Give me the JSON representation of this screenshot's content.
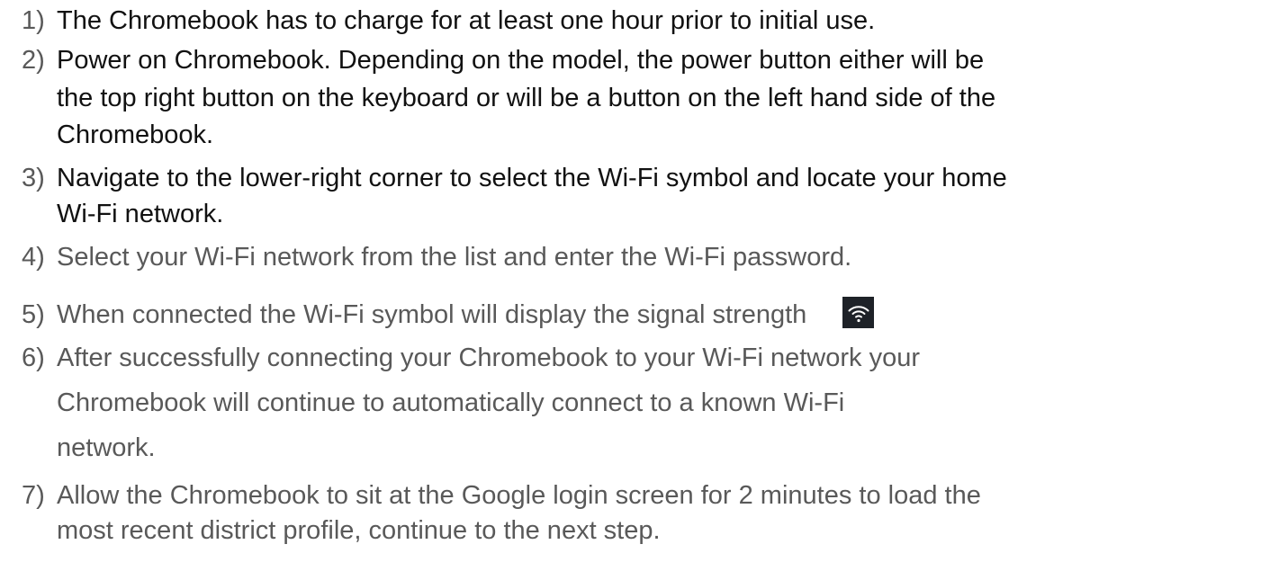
{
  "steps": [
    {
      "number": "1)",
      "lines": [
        "The Chromebook has to charge for at least one hour prior to initial use."
      ]
    },
    {
      "number": "2)",
      "lines": [
        "Power on Chromebook. Depending on the model, the power button either will be",
        "the top right button on the keyboard or will be a button on the left hand side of the",
        "Chromebook."
      ]
    },
    {
      "number": "3)",
      "lines": [
        "Navigate to the lower-right corner to select the Wi-Fi symbol and locate your home",
        "Wi-Fi network."
      ]
    },
    {
      "number": "4)",
      "lines": [
        "Select your Wi-Fi network from the list and enter the Wi-Fi password."
      ]
    },
    {
      "number": "5)",
      "lines": [
        "When connected the Wi-Fi symbol will display the signal strength"
      ],
      "icon": "wifi-icon"
    },
    {
      "number": "6)",
      "lines": [
        "After successfully connecting your Chromebook to your Wi-Fi network your",
        "Chromebook will continue to automatically connect to a known Wi-Fi",
        "network."
      ]
    },
    {
      "number": "7)",
      "lines": [
        "Allow the Chromebook to sit at the Google login screen for 2 minutes to load the",
        "most recent district profile, continue to the next step."
      ]
    }
  ],
  "colors": {
    "text_dark": "#111111",
    "text_gray": "#595959",
    "icon_bg": "#1e2228",
    "icon_fg": "#ffffff"
  }
}
